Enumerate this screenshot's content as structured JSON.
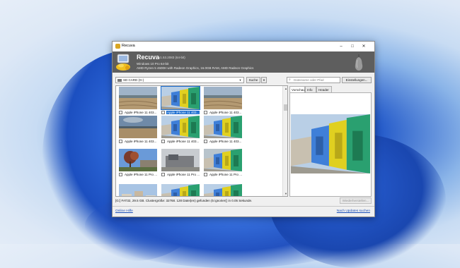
{
  "window": {
    "title": "Recuva",
    "controls": {
      "minimize": "–",
      "maximize": "□",
      "close": "✕"
    }
  },
  "header": {
    "app_name": "Recuva",
    "version": "v1.53.2083 (64-bit)",
    "os": "Windows 10 Pro 64-bit",
    "hardware": "AMD Ryzen 5 4600H with Radeon Graphics, 16.0GB RAM, AMD Radeon Graphics"
  },
  "toolbar": {
    "drive": "SD CARD (G:)",
    "search_label": "Suche",
    "filename_placeholder": "Dateiname oder Pfad",
    "settings_label": "Einstellungen..."
  },
  "files": [
    {
      "label": "Apple iPhone 11 403...",
      "selected": false,
      "photo": "beach-sand"
    },
    {
      "label": "Apple iPhone 11 403...",
      "selected": true,
      "photo": "huts"
    },
    {
      "label": "Apple iPhone 11 403...",
      "selected": false,
      "photo": "beach-sand"
    },
    {
      "label": "Apple iPhone 11 403...",
      "selected": false,
      "photo": "beach-sky"
    },
    {
      "label": "Apple iPhone 11 403...",
      "selected": false,
      "photo": "huts"
    },
    {
      "label": "Apple iPhone 11 403...",
      "selected": false,
      "photo": "huts"
    },
    {
      "label": "Apple iPhone 11 Pro ...",
      "selected": false,
      "photo": "tree"
    },
    {
      "label": "Apple iPhone 11 Pro ...",
      "selected": false,
      "photo": "scrap"
    },
    {
      "label": "Apple iPhone 11 Pro ...",
      "selected": false,
      "photo": "huts-road"
    },
    {
      "label": "",
      "selected": false,
      "photo": "houses"
    },
    {
      "label": "",
      "selected": false,
      "photo": "huts"
    },
    {
      "label": "",
      "selected": false,
      "photo": "huts"
    }
  ],
  "preview": {
    "tabs": [
      "Vorschau",
      "Info",
      "Header"
    ],
    "active_tab": "Vorschau",
    "photo": "huts"
  },
  "status": {
    "text": "[G:] FAT32, 29.5 GB. Clustergröße: 32768. 128 Datei(en) gefunden (5 ignorier() in 0.05 Sekunde.",
    "recover_label": "Wiederherstellen..."
  },
  "footer": {
    "help": "Online Hilfe",
    "updates": "Nach Updates suchen"
  },
  "colors": {
    "header_bg": "#5e5e5e",
    "selection": "#1e6fd0",
    "link": "#1a4fb8"
  }
}
